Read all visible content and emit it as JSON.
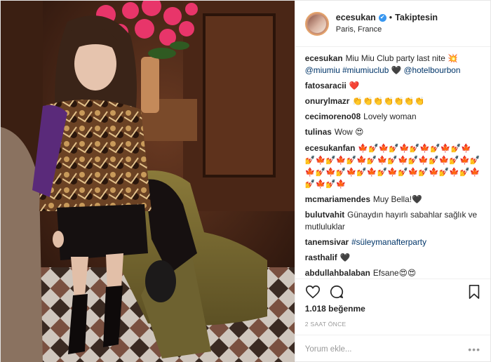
{
  "header": {
    "username": "ecesukan",
    "verified_glyph": "✔",
    "separator": "•",
    "follow_label": "Takiptesin",
    "location": "Paris, France"
  },
  "comments": [
    {
      "user": "ecesukan",
      "parts": [
        {
          "text": "Miu Miu Club party last nite 💥 ",
          "tag": false
        },
        {
          "text": "@miumiu",
          "tag": true
        },
        {
          "text": " ",
          "tag": false
        },
        {
          "text": "#miumiuclub",
          "tag": true
        },
        {
          "text": " 🖤 ",
          "tag": false
        },
        {
          "text": "@hotelbourbon",
          "tag": true
        }
      ]
    },
    {
      "user": "fatosaracii",
      "parts": [
        {
          "text": "❤️",
          "tag": false
        }
      ]
    },
    {
      "user": "onurylmazr",
      "parts": [
        {
          "text": "👏👏👏👏👏👏👏",
          "tag": false
        }
      ]
    },
    {
      "user": "cecimoreno08",
      "parts": [
        {
          "text": "Lovely woman",
          "tag": false
        }
      ]
    },
    {
      "user": "tulinas",
      "parts": [
        {
          "text": "Wow 😍",
          "tag": false
        }
      ]
    },
    {
      "user": "ecesukanfan",
      "parts": [
        {
          "text": "🍁💅🍁💅🍁💅🍁💅🍁💅🍁💅🍁💅🍁💅🍁💅🍁💅🍁💅🍁💅🍁💅🍁💅🍁💅🍁💅🍁💅🍁💅🍁💅🍁💅🍁💅🍁💅🍁💅🍁💅🍁",
          "tag": false
        }
      ]
    },
    {
      "user": "mcmariamendes",
      "parts": [
        {
          "text": "Muy Bella!🖤",
          "tag": false
        }
      ]
    },
    {
      "user": "bulutvahit",
      "parts": [
        {
          "text": "Günaydın hayırlı sabahlar sağlık ve mutluluklar",
          "tag": false
        }
      ]
    },
    {
      "user": "tanemsivar",
      "parts": [
        {
          "text": "#süleymanafterparty",
          "tag": true
        }
      ]
    },
    {
      "user": "rasthalif",
      "parts": [
        {
          "text": "🖤",
          "tag": false
        }
      ]
    },
    {
      "user": "abdullahbalaban",
      "parts": [
        {
          "text": "Efsane😍😍",
          "tag": false
        }
      ]
    }
  ],
  "actions": {
    "like_icon": "heart-icon",
    "comment_icon": "comment-icon",
    "save_icon": "bookmark-icon"
  },
  "likes_text": "1.018 beğenme",
  "timestamp": "2 SAAT ÖNCE",
  "comment_input": {
    "placeholder": "Yorum ekle...",
    "more_label": "•••"
  },
  "colors": {
    "link": "#003569",
    "verified": "#3897f0",
    "muted": "#999999"
  }
}
